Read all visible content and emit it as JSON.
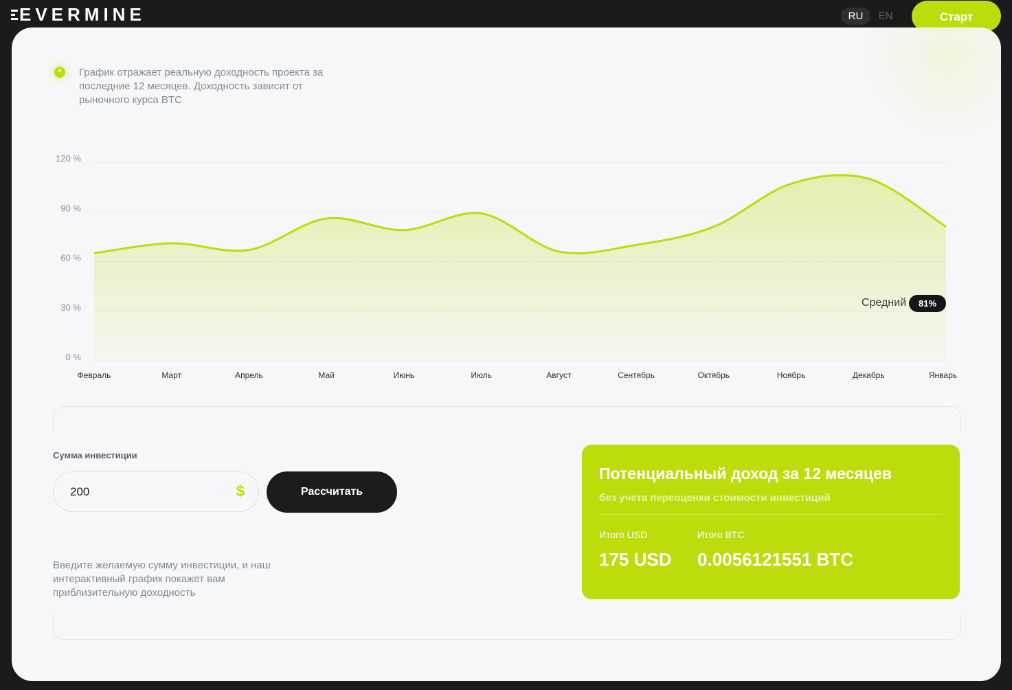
{
  "header": {
    "logo_text": "EVERMINE",
    "lang_ru": "RU",
    "lang_en": "EN",
    "start_label": "Старт"
  },
  "note": {
    "icon": "asterisk-icon",
    "icon_glyph": "*",
    "text": "График отражает реальную доходность проекта за последние 12 месяцев. Доходность зависит от рыночного курса BTC"
  },
  "chart_data": {
    "type": "area",
    "categories": [
      "Февраль",
      "Март",
      "Апрель",
      "Май",
      "Июнь",
      "Июль",
      "Август",
      "Сентябрь",
      "Октябрь",
      "Ноябрь",
      "Декабрь",
      "Январь"
    ],
    "values": [
      65,
      71,
      67,
      86,
      79,
      89,
      66,
      70,
      81,
      107,
      110,
      81
    ],
    "y_ticks": [
      "0 %",
      "30 %",
      "60 %",
      "90 %",
      "120 %"
    ],
    "ylim": [
      0,
      120
    ],
    "grid": true,
    "color": "#bddc0c",
    "average_label": "Средний",
    "average_value": "81%"
  },
  "calculator": {
    "label": "Сумма инвестиции",
    "value": "200",
    "currency_icon": "dollar-icon",
    "currency_glyph": "$",
    "button_label": "Рассчитать",
    "help_text": "Введите желаемую сумму инвестиции, и наш интерактивный график покажет вам приблизительную доходность"
  },
  "income": {
    "title": "Потенциальный доход за 12 месяцев",
    "subtitle": "без учета переоценки стоимости инвестиций",
    "usd_label": "Итого USD",
    "usd_value": "175 USD",
    "btc_label": "Итого BTC",
    "btc_value": "0.0056121551 BTC"
  },
  "colors": {
    "accent": "#bddc0c",
    "dark": "#1b1d1c",
    "card": "#f6f7f8"
  }
}
